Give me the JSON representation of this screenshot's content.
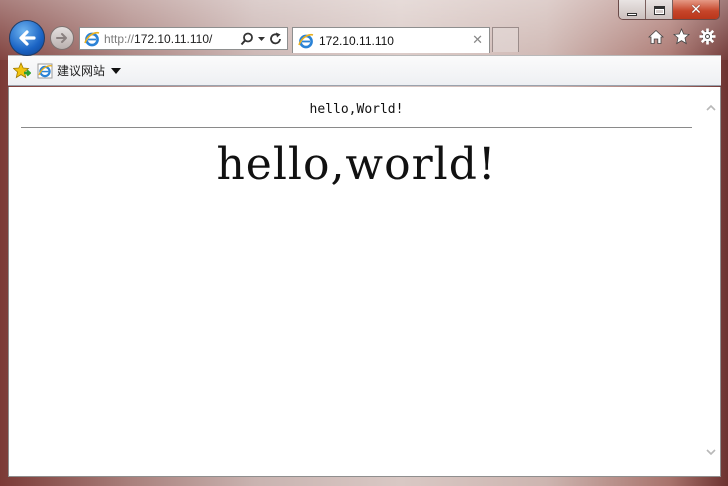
{
  "window": {
    "minimize_icon": "minimize-icon",
    "maximize_icon": "maximize-icon",
    "close_icon": "close-icon",
    "close_glyph": "✕"
  },
  "nav": {
    "back_icon": "back-arrow-icon",
    "forward_icon": "forward-arrow-icon"
  },
  "address": {
    "protocol": "http://",
    "host": "172.10.11.110/"
  },
  "tab": {
    "title": "172.10.11.110",
    "close_glyph": "✕"
  },
  "toolbar": {
    "home_icon": "home-icon",
    "favorites_icon": "star-icon",
    "tools_icon": "gear-icon"
  },
  "favorites_bar": {
    "suggested_sites_label": "建议网站"
  },
  "page": {
    "small_heading": "hello,World!",
    "large_heading": "hello,world!"
  },
  "colors": {
    "back_button": "#1a63c4",
    "close_button": "#c6452a"
  }
}
